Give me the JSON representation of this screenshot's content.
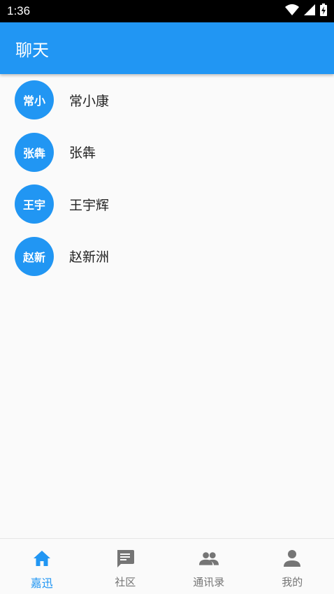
{
  "status_bar": {
    "time": "1:36",
    "icons": [
      "wifi-icon",
      "cellular-signal-icon",
      "battery-charging-icon"
    ]
  },
  "app_bar": {
    "title": "聊天"
  },
  "chats": [
    {
      "avatar_text": "常小",
      "name": "常小康"
    },
    {
      "avatar_text": "张犇",
      "name": "张犇"
    },
    {
      "avatar_text": "王宇",
      "name": "王宇辉"
    },
    {
      "avatar_text": "赵新",
      "name": "赵新洲"
    }
  ],
  "bottom_nav": {
    "items": [
      {
        "label": "嘉迅",
        "icon": "home-icon",
        "active": true
      },
      {
        "label": "社区",
        "icon": "message-icon",
        "active": false
      },
      {
        "label": "通讯录",
        "icon": "people-icon",
        "active": false
      },
      {
        "label": "我的",
        "icon": "person-icon",
        "active": false
      }
    ]
  },
  "colors": {
    "primary": "#2196f3",
    "inactive": "#757575",
    "background": "#fafafa"
  }
}
